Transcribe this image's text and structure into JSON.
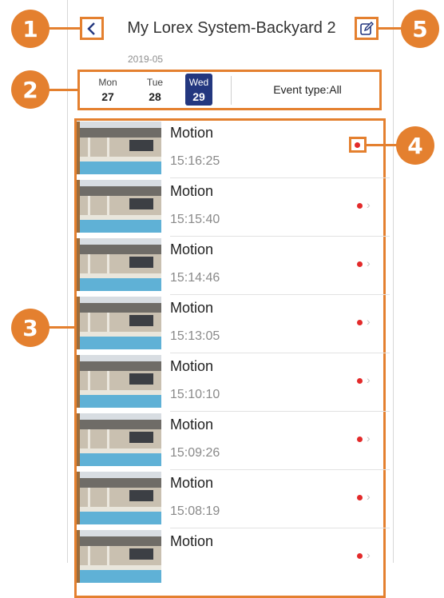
{
  "header": {
    "title": "My Lorex System-Backyard 2",
    "back_icon": "chevron-left-icon",
    "edit_icon": "edit-icon"
  },
  "date_bar": {
    "month": "2019-05",
    "days": [
      {
        "name": "Mon",
        "num": "27",
        "selected": false
      },
      {
        "name": "Tue",
        "num": "28",
        "selected": false
      },
      {
        "name": "Wed",
        "num": "29",
        "selected": true
      }
    ],
    "event_type": "Event type:All"
  },
  "events": [
    {
      "title": "Motion",
      "time": "15:16:25"
    },
    {
      "title": "Motion",
      "time": "15:15:40"
    },
    {
      "title": "Motion",
      "time": "15:14:46"
    },
    {
      "title": "Motion",
      "time": "15:13:05"
    },
    {
      "title": "Motion",
      "time": "15:10:10"
    },
    {
      "title": "Motion",
      "time": "15:09:26"
    },
    {
      "title": "Motion",
      "time": "15:08:19"
    },
    {
      "title": "Motion",
      "time": ""
    }
  ],
  "callouts": [
    "1",
    "2",
    "3",
    "4",
    "5"
  ],
  "colors": {
    "callout": "#e4802f",
    "selected_day": "#23377f",
    "event_dot": "#e32a2a"
  }
}
